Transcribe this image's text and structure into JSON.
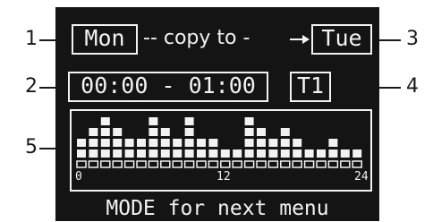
{
  "callouts": [
    "1",
    "2",
    "3",
    "4",
    "5"
  ],
  "screen": {
    "source_day": "Mon",
    "copy_text": "-- copy to -",
    "arrow_icon": "arrow-right-icon",
    "target_day": "Tue",
    "time_range": "00:00 - 01:00",
    "temperature_level": "T1",
    "footer": "MODE for next menu"
  },
  "histogram": {
    "axis_labels": [
      "0",
      "12",
      "24"
    ],
    "levels": [
      2,
      3,
      4,
      3,
      2,
      2,
      4,
      3,
      2,
      4,
      2,
      2,
      1,
      1,
      4,
      3,
      2,
      3,
      2,
      1,
      1,
      2,
      1,
      1
    ],
    "max_level": 4
  },
  "colors": {
    "screen_bg": "#141414",
    "pixel": "#f2f2f2",
    "callout": "#1a1a1a"
  }
}
